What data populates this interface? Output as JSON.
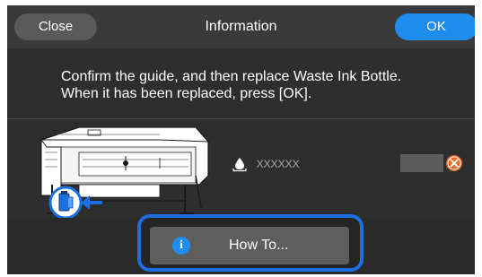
{
  "header": {
    "close_label": "Close",
    "title": "Information",
    "ok_label": "OK"
  },
  "message": {
    "line1": "Confirm the guide, and then replace Waste Ink Bottle.",
    "line2": "When it has been replaced, press [OK]."
  },
  "ink_status": {
    "icon": "ink-drop-icon",
    "model_code": "XXXXXX",
    "status_icon": "error-x-icon"
  },
  "footer": {
    "howto_label": "How To...",
    "howto_icon": "info-icon",
    "howto_icon_glyph": "i"
  },
  "colors": {
    "accent": "#1f8cf0",
    "highlight": "#1b6fe0",
    "error": "#f26522",
    "background": "#2e2e2e"
  }
}
